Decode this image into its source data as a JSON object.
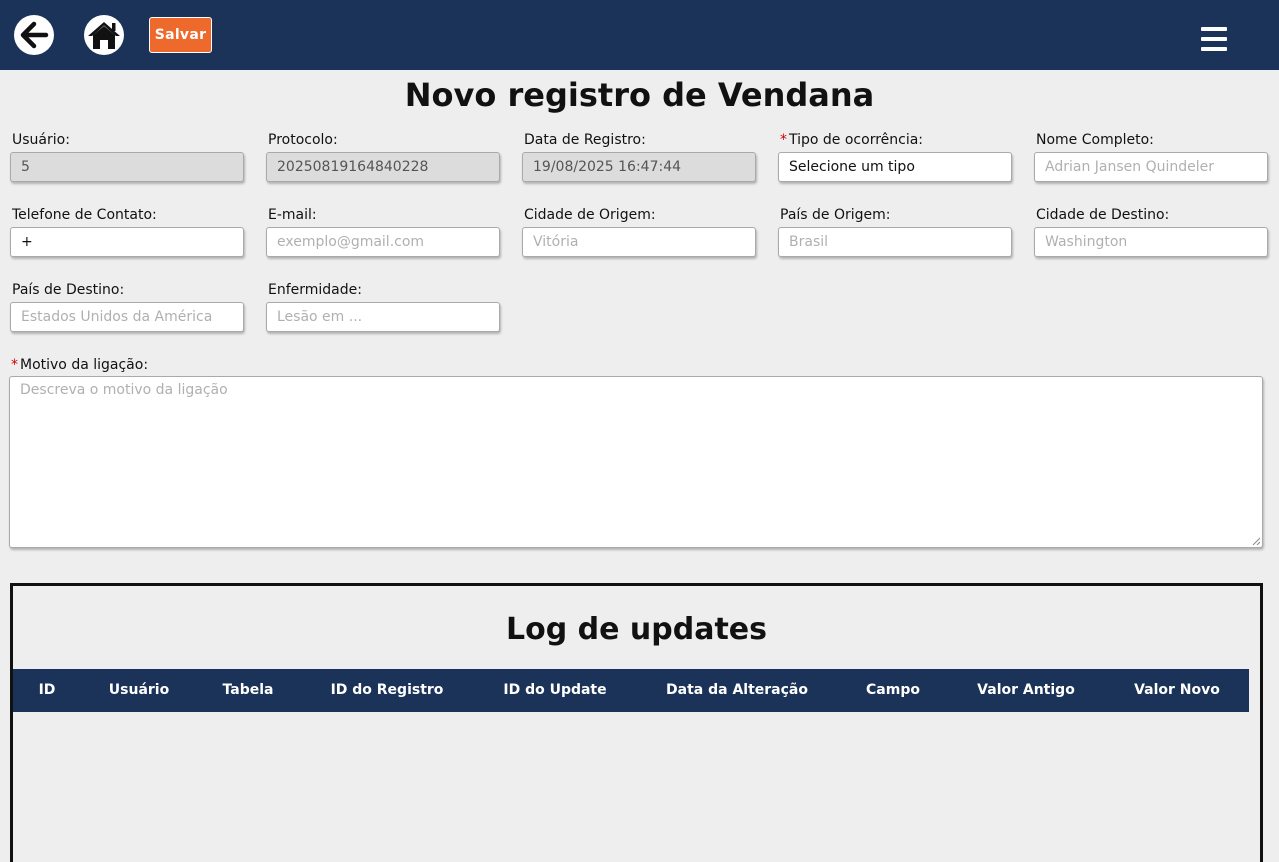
{
  "header": {
    "back_icon": "arrow-left-icon",
    "home_icon": "home-icon",
    "save_label": "Salvar",
    "menu_icon": "hamburger-menu-icon",
    "bar_color": "#1b3358",
    "save_color": "#ee6a2c"
  },
  "page": {
    "title": "Novo registro de Vendana"
  },
  "form": {
    "usuario": {
      "label": "Usuário:",
      "value": "5"
    },
    "protocolo": {
      "label": "Protocolo:",
      "value": "20250819164840228"
    },
    "data_registro": {
      "label": "Data de Registro:",
      "value": "19/08/2025 16:47:44"
    },
    "tipo_ocorrencia": {
      "required_mark": "*",
      "label": "Tipo de ocorrência:",
      "value": "Selecione um tipo"
    },
    "nome_completo": {
      "label": "Nome Completo:",
      "placeholder": "Adrian Jansen Quindeler"
    },
    "telefone": {
      "label": "Telefone de Contato:",
      "value": "+"
    },
    "email": {
      "label": "E-mail:",
      "placeholder": "exemplo@gmail.com"
    },
    "cidade_origem": {
      "label": "Cidade de Origem:",
      "placeholder": "Vitória"
    },
    "pais_origem": {
      "label": "País de Origem:",
      "placeholder": "Brasil"
    },
    "cidade_destino": {
      "label": "Cidade de Destino:",
      "placeholder": "Washington"
    },
    "pais_destino": {
      "label": "País de Destino:",
      "placeholder": "Estados Unidos da América"
    },
    "enfermidade": {
      "label": "Enfermidade:",
      "placeholder": "Lesão em ..."
    },
    "motivo": {
      "required_mark": "*",
      "label": "Motivo da ligação:",
      "placeholder": "Descreva o motivo da ligação"
    }
  },
  "log": {
    "title": "Log de updates",
    "columns": [
      "ID",
      "Usuário",
      "Tabela",
      "ID do Registro",
      "ID do Update",
      "Data da Alteração",
      "Campo",
      "Valor Antigo",
      "Valor Novo"
    ],
    "rows": []
  }
}
